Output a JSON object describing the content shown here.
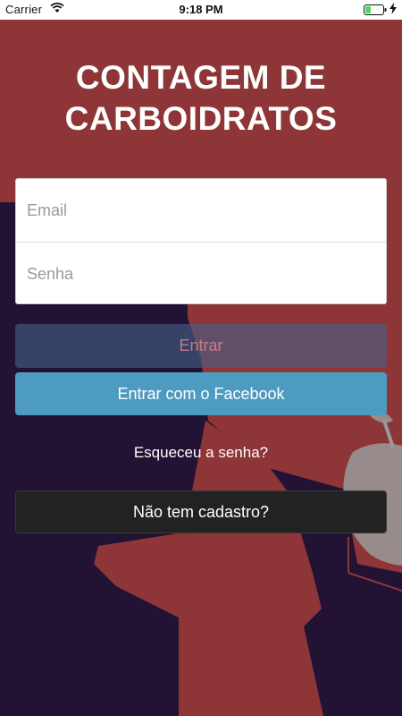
{
  "status_bar": {
    "carrier": "Carrier",
    "time": "9:18 PM"
  },
  "app": {
    "title": "CONTAGEM DE CARBOIDRATOS"
  },
  "login_form": {
    "email_placeholder": "Email",
    "password_placeholder": "Senha"
  },
  "buttons": {
    "login_label": "Entrar",
    "facebook_label": "Entrar com o Facebook",
    "forgot_password_label": "Esqueceu a senha?",
    "signup_label": "Não tem cadastro?"
  },
  "colors": {
    "background_red": "#8e3537",
    "background_dark": "#221334",
    "facebook_blue": "#4e9bc2",
    "signup_dark": "#222222"
  },
  "icons": [
    "wifi-icon",
    "battery-icon",
    "charging-bolt-icon",
    "apple-illustration"
  ]
}
